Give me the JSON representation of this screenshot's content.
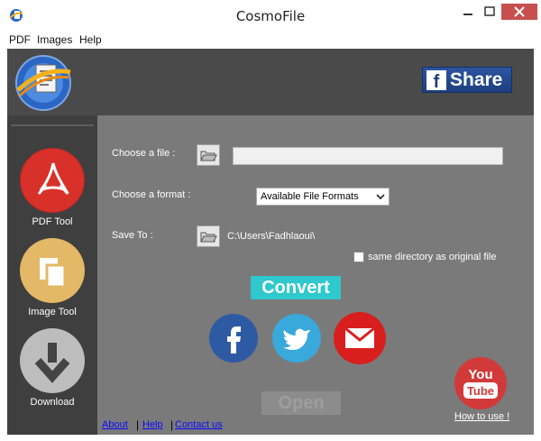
{
  "window": {
    "title": "CosmoFile",
    "controls": {
      "minimize": "minimize-icon",
      "maximize": "maximize-icon",
      "close": "close-icon"
    }
  },
  "menu": {
    "items": [
      {
        "label": "PDF"
      },
      {
        "label": "Images"
      },
      {
        "label": "Help"
      }
    ]
  },
  "header": {
    "share_label": "Share"
  },
  "sidebar": {
    "tools": [
      {
        "label": "PDF Tool",
        "icon": "pdf-icon",
        "color": "#d8312a"
      },
      {
        "label": "Image Tool",
        "icon": "image-icon",
        "color": "#e3b866"
      },
      {
        "label": "Download",
        "icon": "download-icon",
        "color": "#bdbdbd"
      }
    ]
  },
  "form": {
    "choose_file_label": "Choose a file :",
    "file_value": "",
    "choose_format_label": "Choose a format :",
    "format_selected": "Available File Formats",
    "save_to_label": "Save To :",
    "save_path": "C:\\Users\\Fadhlaoui\\",
    "same_dir_label": "same directory as original file",
    "same_dir_checked": false,
    "convert_label": "Convert",
    "open_label": "Open"
  },
  "social": {
    "facebook_color": "#2e5aa4",
    "twitter_color": "#39a9db",
    "email_color": "#d91e1e"
  },
  "youtube": {
    "logo_top": "You",
    "logo_bottom": "Tube",
    "howto_label": "How to use !"
  },
  "footer": {
    "about": "About",
    "help": "Help",
    "contact": "Contact us"
  },
  "colors": {
    "accent": "#2ec8cd",
    "header_bg": "#4a4a4a",
    "sidebar_bg": "#3f3f3f",
    "main_bg": "#7a7a7a"
  }
}
